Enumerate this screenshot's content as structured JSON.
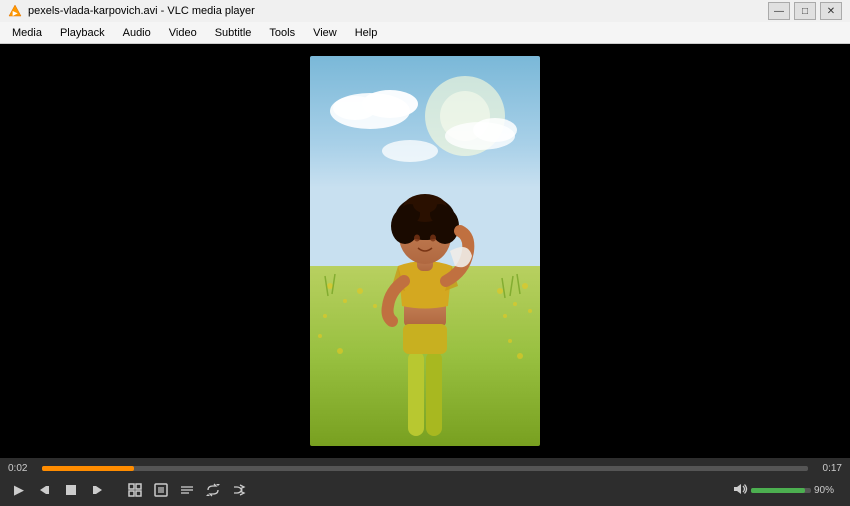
{
  "titlebar": {
    "title": "pexels-vlada-karpovich.avi - VLC media player",
    "minimize_label": "—",
    "maximize_label": "□",
    "close_label": "✕"
  },
  "menubar": {
    "items": [
      {
        "label": "Media"
      },
      {
        "label": "Playback"
      },
      {
        "label": "Audio"
      },
      {
        "label": "Video"
      },
      {
        "label": "Subtitle"
      },
      {
        "label": "Tools"
      },
      {
        "label": "View"
      },
      {
        "label": "Help"
      }
    ]
  },
  "controls": {
    "time_current": "0:02",
    "time_total": "0:17",
    "volume_pct": "90%",
    "buttons": {
      "play": "▶",
      "prev": "⏮",
      "stop": "⏹",
      "next": "⏭",
      "fullscreen": "⛶",
      "extended": "⊞",
      "playlist": "☰",
      "loop": "↺",
      "random": "⇄",
      "record": "⏺"
    }
  }
}
